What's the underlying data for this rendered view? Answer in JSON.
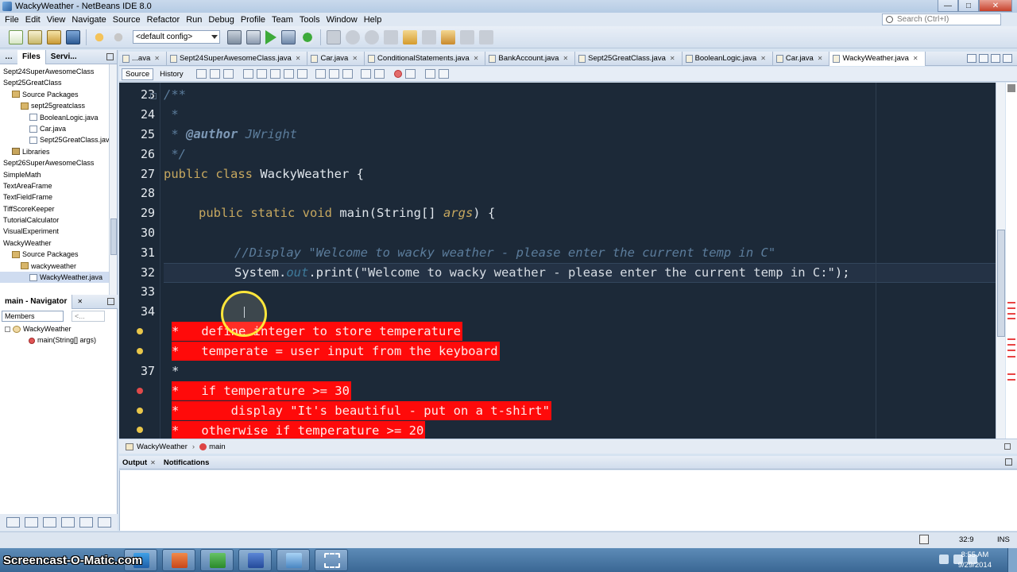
{
  "window": {
    "title": "WackyWeather - NetBeans IDE 8.0"
  },
  "menubar": {
    "items": [
      "File",
      "Edit",
      "View",
      "Navigate",
      "Source",
      "Refactor",
      "Run",
      "Debug",
      "Profile",
      "Team",
      "Tools",
      "Window",
      "Help"
    ]
  },
  "search": {
    "placeholder": "Search (Ctrl+I)"
  },
  "toolbar": {
    "config": "<default config>"
  },
  "projects_panel": {
    "tabs": [
      "Files",
      "Servi..."
    ],
    "items": [
      {
        "label": "Sept24SuperAwesomeClass",
        "indent": 0,
        "icon": "project"
      },
      {
        "label": "Sept25GreatClass",
        "indent": 0,
        "icon": "project"
      },
      {
        "label": "Source Packages",
        "indent": 1,
        "icon": "folder"
      },
      {
        "label": "sept25greatclass",
        "indent": 2,
        "icon": "package"
      },
      {
        "label": "BooleanLogic.java",
        "indent": 3,
        "icon": "file"
      },
      {
        "label": "Car.java",
        "indent": 3,
        "icon": "file"
      },
      {
        "label": "Sept25GreatClass.java",
        "indent": 3,
        "icon": "file"
      },
      {
        "label": "Libraries",
        "indent": 1,
        "icon": "library"
      },
      {
        "label": "Sept26SuperAwesomeClass",
        "indent": 0,
        "icon": "project"
      },
      {
        "label": "SimpleMath",
        "indent": 0,
        "icon": "project"
      },
      {
        "label": "TextAreaFrame",
        "indent": 0,
        "icon": "project"
      },
      {
        "label": "TextFieldFrame",
        "indent": 0,
        "icon": "project"
      },
      {
        "label": "TiffScoreKeeper",
        "indent": 0,
        "icon": "project"
      },
      {
        "label": "TutorialCalculator",
        "indent": 0,
        "icon": "project"
      },
      {
        "label": "VisualExperiment",
        "indent": 0,
        "icon": "project"
      },
      {
        "label": "WackyWeather",
        "indent": 0,
        "icon": "project"
      },
      {
        "label": "Source Packages",
        "indent": 1,
        "icon": "folder"
      },
      {
        "label": "wackyweather",
        "indent": 2,
        "icon": "package"
      },
      {
        "label": "WackyWeather.java",
        "indent": 3,
        "icon": "file",
        "selected": true
      }
    ]
  },
  "navigator": {
    "title": "main - Navigator",
    "filter": "Members",
    "filter2": "<...",
    "items": [
      {
        "label": "WackyWeather",
        "indent": 0
      },
      {
        "label": "main(String[] args)",
        "indent": 1
      }
    ]
  },
  "editor_tabs": [
    {
      "label": "...ava",
      "active": false
    },
    {
      "label": "Sept24SuperAwesomeClass.java",
      "active": false
    },
    {
      "label": "Car.java",
      "active": false
    },
    {
      "label": "ConditionalStatements.java",
      "active": false
    },
    {
      "label": "BankAccount.java",
      "active": false
    },
    {
      "label": "Sept25GreatClass.java",
      "active": false
    },
    {
      "label": "BooleanLogic.java",
      "active": false
    },
    {
      "label": "Car.java",
      "active": false
    },
    {
      "label": "WackyWeather.java",
      "active": true
    }
  ],
  "editor_toolbar": {
    "source": "Source",
    "history": "History"
  },
  "code": {
    "line_numbers": [
      "23",
      "24",
      "25",
      "26",
      "27",
      "28",
      "29",
      "30",
      "31",
      "32",
      "33",
      "34",
      "37"
    ],
    "lines": {
      "l23": "/**",
      "l24": " *",
      "l25a": " * ",
      "l25b": "@author",
      "l25c": " JWright",
      "l26": " */",
      "l27a": "public class",
      "l27b": " WackyWeather {",
      "l29a": "public static void",
      "l29b": " main(String[] ",
      "l29c": "args",
      "l29d": ") {",
      "l31": "//Display \"Welcome to wacky weather - please enter the current temp in C\"",
      "l32a": "System.",
      "l32b": "out",
      "l32c": ".print(",
      "l32d": "\"Welcome to wacky weather - please enter the current temp in C:\"",
      "l32e": ");",
      "l37": "*"
    },
    "highlighted": [
      "*   define integer to store temperature",
      "*   temperate = user input from the keyboard",
      "*   if temperature >= 30",
      "*       display \"It's beautiful - put on a t-shirt\"",
      "*   otherwise if temperature >= 20"
    ]
  },
  "breadcrumb": {
    "items": [
      "WackyWeather",
      "main"
    ]
  },
  "output_panel": {
    "tabs": [
      "Output",
      "Notifications"
    ]
  },
  "statusbar": {
    "position": "32:9",
    "mode": "INS"
  },
  "taskbar": {
    "watermark": "Screencast-O-Matic.com",
    "time": "8:55 AM",
    "date": "9/29/2014"
  }
}
